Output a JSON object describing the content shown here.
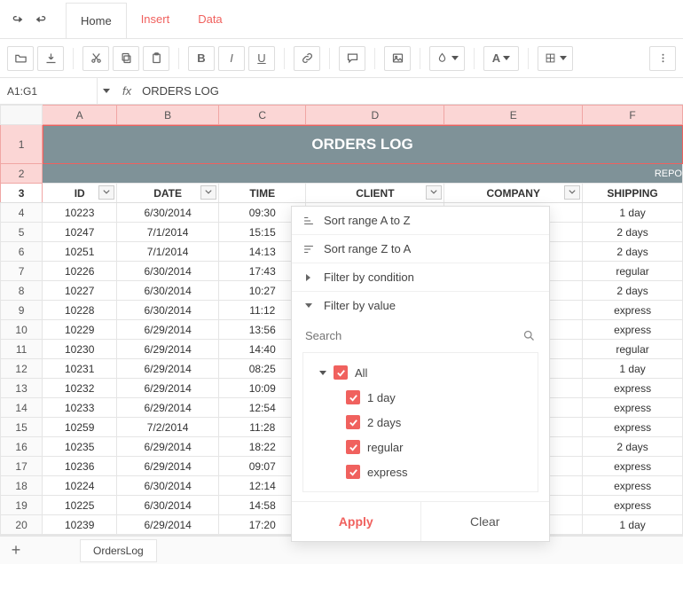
{
  "tabs": {
    "home": "Home",
    "insert": "Insert",
    "data": "Data"
  },
  "formula": {
    "cellref": "A1:G1",
    "fx": "fx",
    "value": "ORDERS LOG"
  },
  "columns": [
    "A",
    "B",
    "C",
    "D",
    "E",
    "F"
  ],
  "title_band": "ORDERS LOG",
  "sub_band": "REPO",
  "headers": {
    "id": "ID",
    "date": "DATE",
    "time": "TIME",
    "client": "CLIENT",
    "company": "COMPANY",
    "shipping": "SHIPPING"
  },
  "rows": [
    {
      "n": 4,
      "id": "10223",
      "date": "6/30/2014",
      "time": "09:30",
      "shipping": "1 day"
    },
    {
      "n": 5,
      "id": "10247",
      "date": "7/1/2014",
      "time": "15:15",
      "shipping": "2 days"
    },
    {
      "n": 6,
      "id": "10251",
      "date": "7/1/2014",
      "time": "14:13",
      "shipping": "2 days"
    },
    {
      "n": 7,
      "id": "10226",
      "date": "6/30/2014",
      "time": "17:43",
      "shipping": "regular"
    },
    {
      "n": 8,
      "id": "10227",
      "date": "6/30/2014",
      "time": "10:27",
      "shipping": "2 days"
    },
    {
      "n": 9,
      "id": "10228",
      "date": "6/30/2014",
      "time": "11:12",
      "shipping": "express"
    },
    {
      "n": 10,
      "id": "10229",
      "date": "6/29/2014",
      "time": "13:56",
      "shipping": "express"
    },
    {
      "n": 11,
      "id": "10230",
      "date": "6/29/2014",
      "time": "14:40",
      "shipping": "regular"
    },
    {
      "n": 12,
      "id": "10231",
      "date": "6/29/2014",
      "time": "08:25",
      "shipping": "1 day"
    },
    {
      "n": 13,
      "id": "10232",
      "date": "6/29/2014",
      "time": "10:09",
      "shipping": "express"
    },
    {
      "n": 14,
      "id": "10233",
      "date": "6/29/2014",
      "time": "12:54",
      "shipping": "express"
    },
    {
      "n": 15,
      "id": "10259",
      "date": "7/2/2014",
      "time": "11:28",
      "shipping": "express"
    },
    {
      "n": 16,
      "id": "10235",
      "date": "6/29/2014",
      "time": "18:22",
      "shipping": "2 days"
    },
    {
      "n": 17,
      "id": "10236",
      "date": "6/29/2014",
      "time": "09:07",
      "shipping": "express"
    },
    {
      "n": 18,
      "id": "10224",
      "date": "6/30/2014",
      "time": "12:14",
      "shipping": "express"
    },
    {
      "n": 19,
      "id": "10225",
      "date": "6/30/2014",
      "time": "14:58",
      "shipping": "express"
    },
    {
      "n": 20,
      "id": "10239",
      "date": "6/29/2014",
      "time": "17:20",
      "shipping": "1 day"
    }
  ],
  "sheet": {
    "name": "OrdersLog"
  },
  "popup": {
    "sort_az": "Sort range A to Z",
    "sort_za": "Sort range Z to A",
    "filter_cond": "Filter by condition",
    "filter_val": "Filter by value",
    "search_ph": "Search",
    "all": "All",
    "opts": [
      "1 day",
      "2 days",
      "regular",
      "express"
    ],
    "apply": "Apply",
    "clear": "Clear"
  }
}
